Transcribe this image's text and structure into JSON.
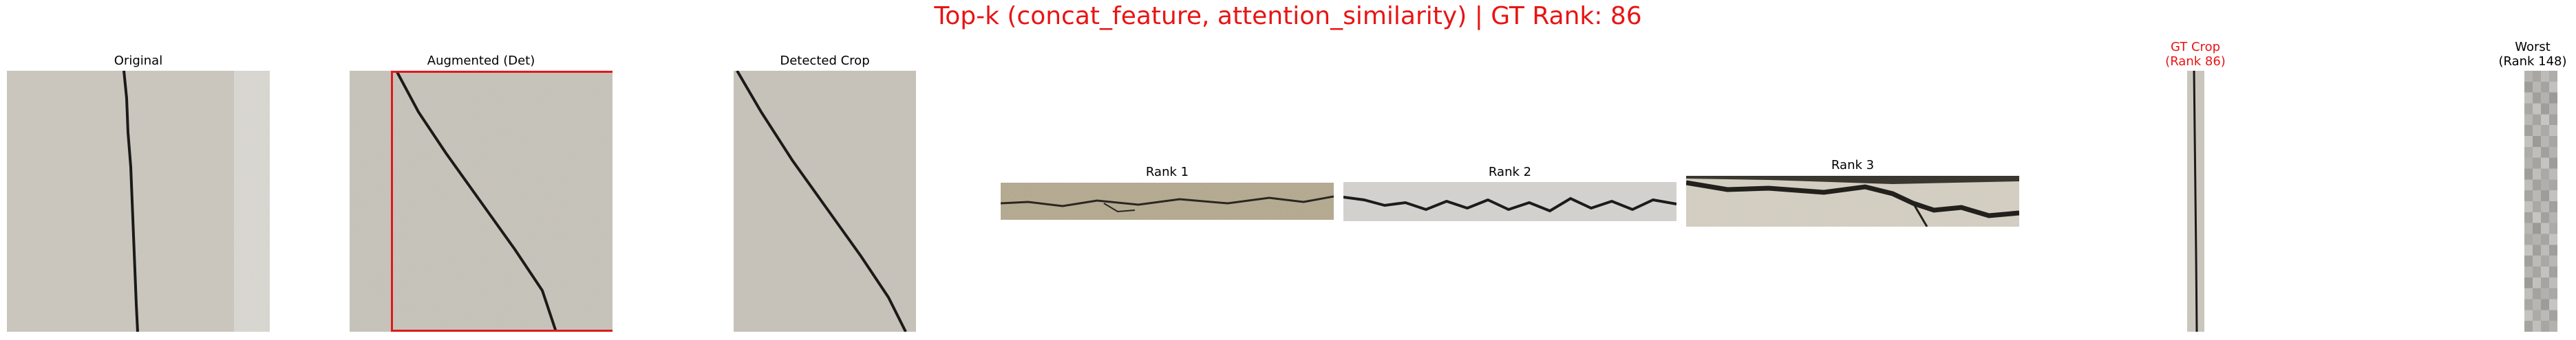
{
  "figure": {
    "title": "Top-k (concat_feature, attention_similarity) | GT Rank: 86",
    "title_color": "#e81414",
    "text_color": "#000000",
    "box_color": "#e0191b"
  },
  "panels": {
    "original": {
      "title": "Original"
    },
    "augmented": {
      "title": "Augmented (Det)"
    },
    "detected": {
      "title": "Detected Crop"
    },
    "rank1": {
      "title": "Rank 1"
    },
    "rank2": {
      "title": "Rank 2"
    },
    "rank3": {
      "title": "Rank 3"
    },
    "gt": {
      "title_line1": "GT Crop",
      "title_line2": "(Rank 86)"
    },
    "worst": {
      "title_line1": "Worst",
      "title_line2": "(Rank 148)"
    }
  }
}
